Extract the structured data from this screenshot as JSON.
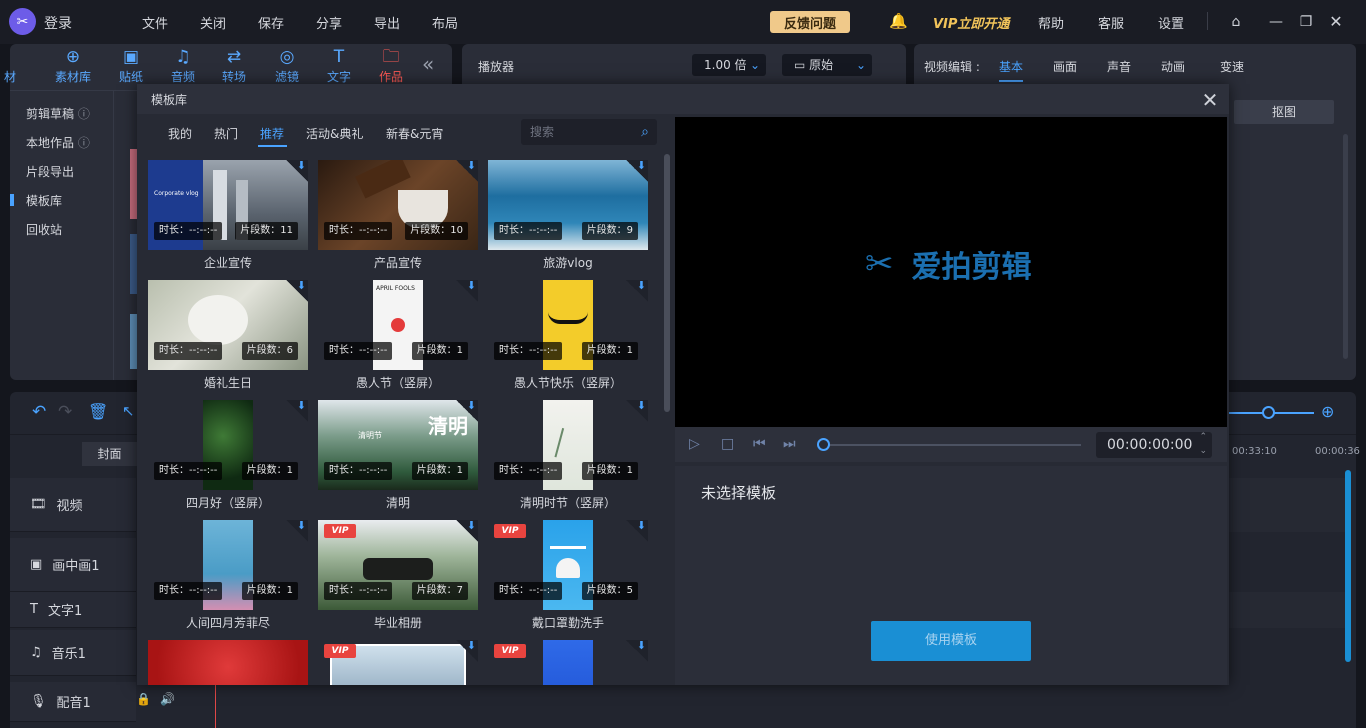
{
  "titlebar": {
    "login": "登录",
    "menu": [
      "文件",
      "关闭",
      "保存",
      "分享",
      "导出",
      "布局"
    ],
    "feedback": "反馈问题",
    "vip": "VIP立即开通",
    "help": "帮助",
    "service": "客服",
    "settings": "设置"
  },
  "toolbar": {
    "items": [
      "素材库",
      "贴纸",
      "音频",
      "转场",
      "滤镜",
      "文字",
      "作品"
    ],
    "partial": "材"
  },
  "sidenav": [
    "剪辑草稿",
    "本地作品",
    "片段导出",
    "模板库",
    "回收站"
  ],
  "player": {
    "title": "播放器",
    "speed": "1.00 倍",
    "ratio": "原始"
  },
  "editor": {
    "title": "视频编辑",
    "colon": ":",
    "tabs": [
      "基本",
      "画面",
      "声音",
      "动画",
      "变速"
    ],
    "matting": "抠图"
  },
  "timeline": {
    "cover": "封面",
    "tracks": [
      "视频",
      "画中画1",
      "文字1",
      "音乐1",
      "配音1"
    ],
    "time1": "00:33:10",
    "time2": "00:00:36"
  },
  "modal": {
    "title": "模板库",
    "tabs": [
      "我的",
      "热门",
      "推荐",
      "活动&典礼",
      "新春&元宵"
    ],
    "search_placeholder": "搜索",
    "duration_label": "时长：--:--:--",
    "segment_prefix": "片段数：",
    "vip_badge": "VIP",
    "templates": [
      {
        "name": "企业宣传",
        "segments": "11"
      },
      {
        "name": "产品宣传",
        "segments": "10"
      },
      {
        "name": "旅游vlog",
        "segments": "9"
      },
      {
        "name": "婚礼生日",
        "segments": "6"
      },
      {
        "name": "愚人节（竖屏）",
        "segments": "1"
      },
      {
        "name": "愚人节快乐（竖屏）",
        "segments": "1"
      },
      {
        "name": "四月好（竖屏）",
        "segments": "1"
      },
      {
        "name": "清明",
        "segments": "1"
      },
      {
        "name": "清明时节（竖屏）",
        "segments": "1"
      },
      {
        "name": "人间四月芳菲尽",
        "segments": "1"
      },
      {
        "name": "毕业相册",
        "segments": "7"
      },
      {
        "name": "戴口罩勤洗手",
        "segments": "5"
      }
    ],
    "preview_brand": "爱拍剪辑",
    "timecode": "00:00:00:00",
    "no_selection": "未选择模板",
    "use_button": "使用模板",
    "thumb_texts": [
      "Corporate vlog",
      "APRIL FOOLS",
      "清明节",
      "清明"
    ]
  }
}
